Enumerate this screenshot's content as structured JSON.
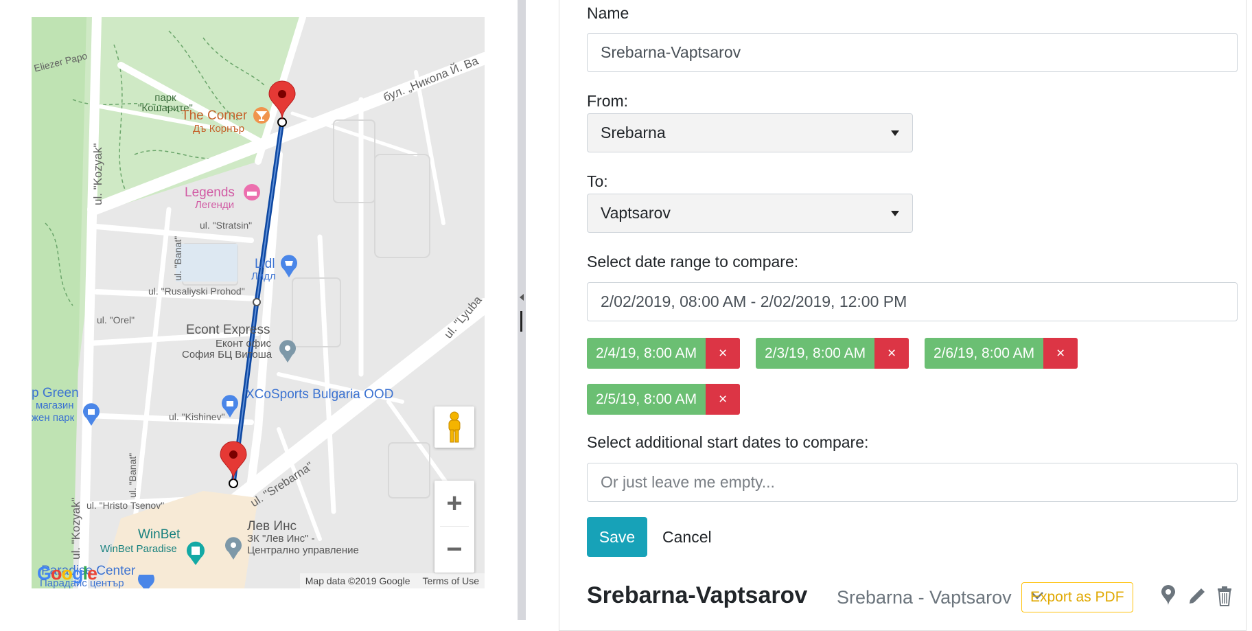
{
  "map": {
    "labels": {
      "eliezer": "Eliezer Papo",
      "blvd": "бул. „Никола Й. Ва",
      "park_line1": "парк",
      "park_line2": "\"Кошарите\"",
      "corner": "The Corner",
      "corner_bg": "Дъ Корнър",
      "legends": "Legends",
      "legends_bg": "Легенди",
      "stratsin": "ul. \"Stratsin\"",
      "banat1": "ul. \"Banat\"",
      "lidl": "Lidl",
      "lidl_bg": "Лидл",
      "rusaliyski": "ul. \"Rusaliyski Prohod\"",
      "orel": "ul. \"Orel\"",
      "econt": "Econt Express",
      "econt_bg1": "Еконт офис",
      "econt_bg2": "София БЦ Витоша",
      "green1": "p Green",
      "green2": "магазин",
      "green3": "жен парк",
      "xco": "XCoSports Bulgaria OOD",
      "kishinev": "ul. \"Kishinev\"",
      "srebarna": "ul. \"Srebarna\"",
      "banat2": "ul. \"Banat\"",
      "hristo": "ul. \"Hristo Tsenov\"",
      "kozyak1": "ul. \"Kozyak\"",
      "kozyak2": "ul. \"Kozyak\"",
      "lyuba": "ul. \"Lyuba",
      "winbet": "WinBet",
      "winbet_paradise": "WinBet Paradise",
      "lev": "Лев Инс",
      "lev_sub1": "ЗК \"Лев Инс\" -",
      "lev_sub2": "Централно управление",
      "paradise": "Paradise Center",
      "paradise_bg": "Парадайс център"
    },
    "zoom_in": "+",
    "zoom_out": "−",
    "footer_data": "Map data ©2019 Google",
    "footer_terms": "Terms of Use",
    "logo": {
      "g1": "G",
      "o1": "o",
      "o2": "o",
      "g2": "g",
      "l": "l",
      "e": "e"
    }
  },
  "form": {
    "name_label": "Name",
    "name_value": "Srebarna-Vaptsarov",
    "from_label": "From:",
    "from_value": "Srebarna",
    "to_label": "To:",
    "to_value": "Vaptsarov",
    "range_label": "Select date range to compare:",
    "range_value": "2/02/2019, 08:00 AM - 2/02/2019, 12:00 PM",
    "chips": [
      {
        "label": "2/4/19, 8:00 AM",
        "remove": "×"
      },
      {
        "label": "2/3/19, 8:00 AM",
        "remove": "×"
      },
      {
        "label": "2/6/19, 8:00 AM",
        "remove": "×"
      },
      {
        "label": "2/5/19, 8:00 AM",
        "remove": "×"
      }
    ],
    "additional_label": "Select additional start dates to compare:",
    "additional_placeholder": "Or just leave me empty...",
    "save": "Save",
    "cancel": "Cancel"
  },
  "route": {
    "title": "Srebarna-Vaptsarov",
    "subtitle": "Srebarna - Vaptsarov",
    "export": "Export as PDF"
  },
  "colors": {
    "chip_green": "#6bbf73",
    "chip_red": "#dc3545",
    "save_teal": "#17a2b8",
    "export_yellow": "#ffc107",
    "route_blue": "#0d47a1",
    "marker_red": "#e53935"
  }
}
